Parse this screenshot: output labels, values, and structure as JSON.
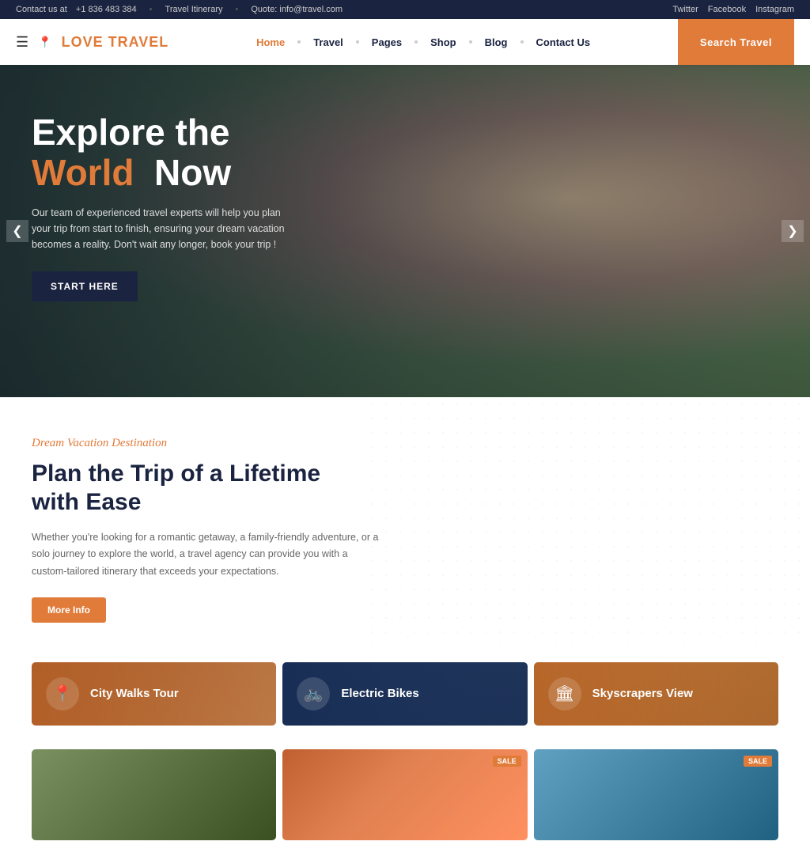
{
  "topbar": {
    "contact_label": "Contact us at",
    "phone": "+1 836 483 384",
    "separator1": "•",
    "itinerary_label": "Travel Itinerary",
    "separator2": "•",
    "quote_label": "Quote: info@travel.com",
    "social": [
      "Twitter",
      "Facebook",
      "Instagram"
    ]
  },
  "navbar": {
    "logo_word1": "LOVE",
    "logo_word2": "TRAVEL",
    "links": [
      {
        "label": "Home",
        "active": true
      },
      {
        "label": "Travel",
        "active": false
      },
      {
        "label": "Pages",
        "active": false
      },
      {
        "label": "Shop",
        "active": false
      },
      {
        "label": "Blog",
        "active": false
      },
      {
        "label": "Contact Us",
        "active": false
      }
    ],
    "search_btn": "Search Travel"
  },
  "hero": {
    "title_line1": "Explore the",
    "title_highlight": "World",
    "title_line2": "Now",
    "description": "Our team of experienced travel experts will help you plan your trip from start to finish, ensuring your dream vacation becomes a reality. Don't wait any longer, book your trip !",
    "cta_label": "START HERE",
    "arrow_left": "❮",
    "arrow_right": "❯"
  },
  "dream_section": {
    "subtitle": "Dream Vacation Destination",
    "title": "Plan the Trip of a Lifetime with Ease",
    "description": "Whether you're looking for a romantic getaway, a family-friendly adventure, or a solo journey to explore the world, a travel agency can provide you with a custom-tailored itinerary that exceeds your expectations.",
    "more_info_label": "More Info"
  },
  "tour_cards": [
    {
      "label": "City Walks Tour",
      "icon": "📍"
    },
    {
      "label": "Electric Bikes",
      "icon": "🚲"
    },
    {
      "label": "Skyscrapers View",
      "icon": "🏛"
    }
  ],
  "product_cards": [
    {
      "sale": false
    },
    {
      "sale": true,
      "sale_label": "SALE"
    },
    {
      "sale": true,
      "sale_label": "SALE"
    }
  ]
}
